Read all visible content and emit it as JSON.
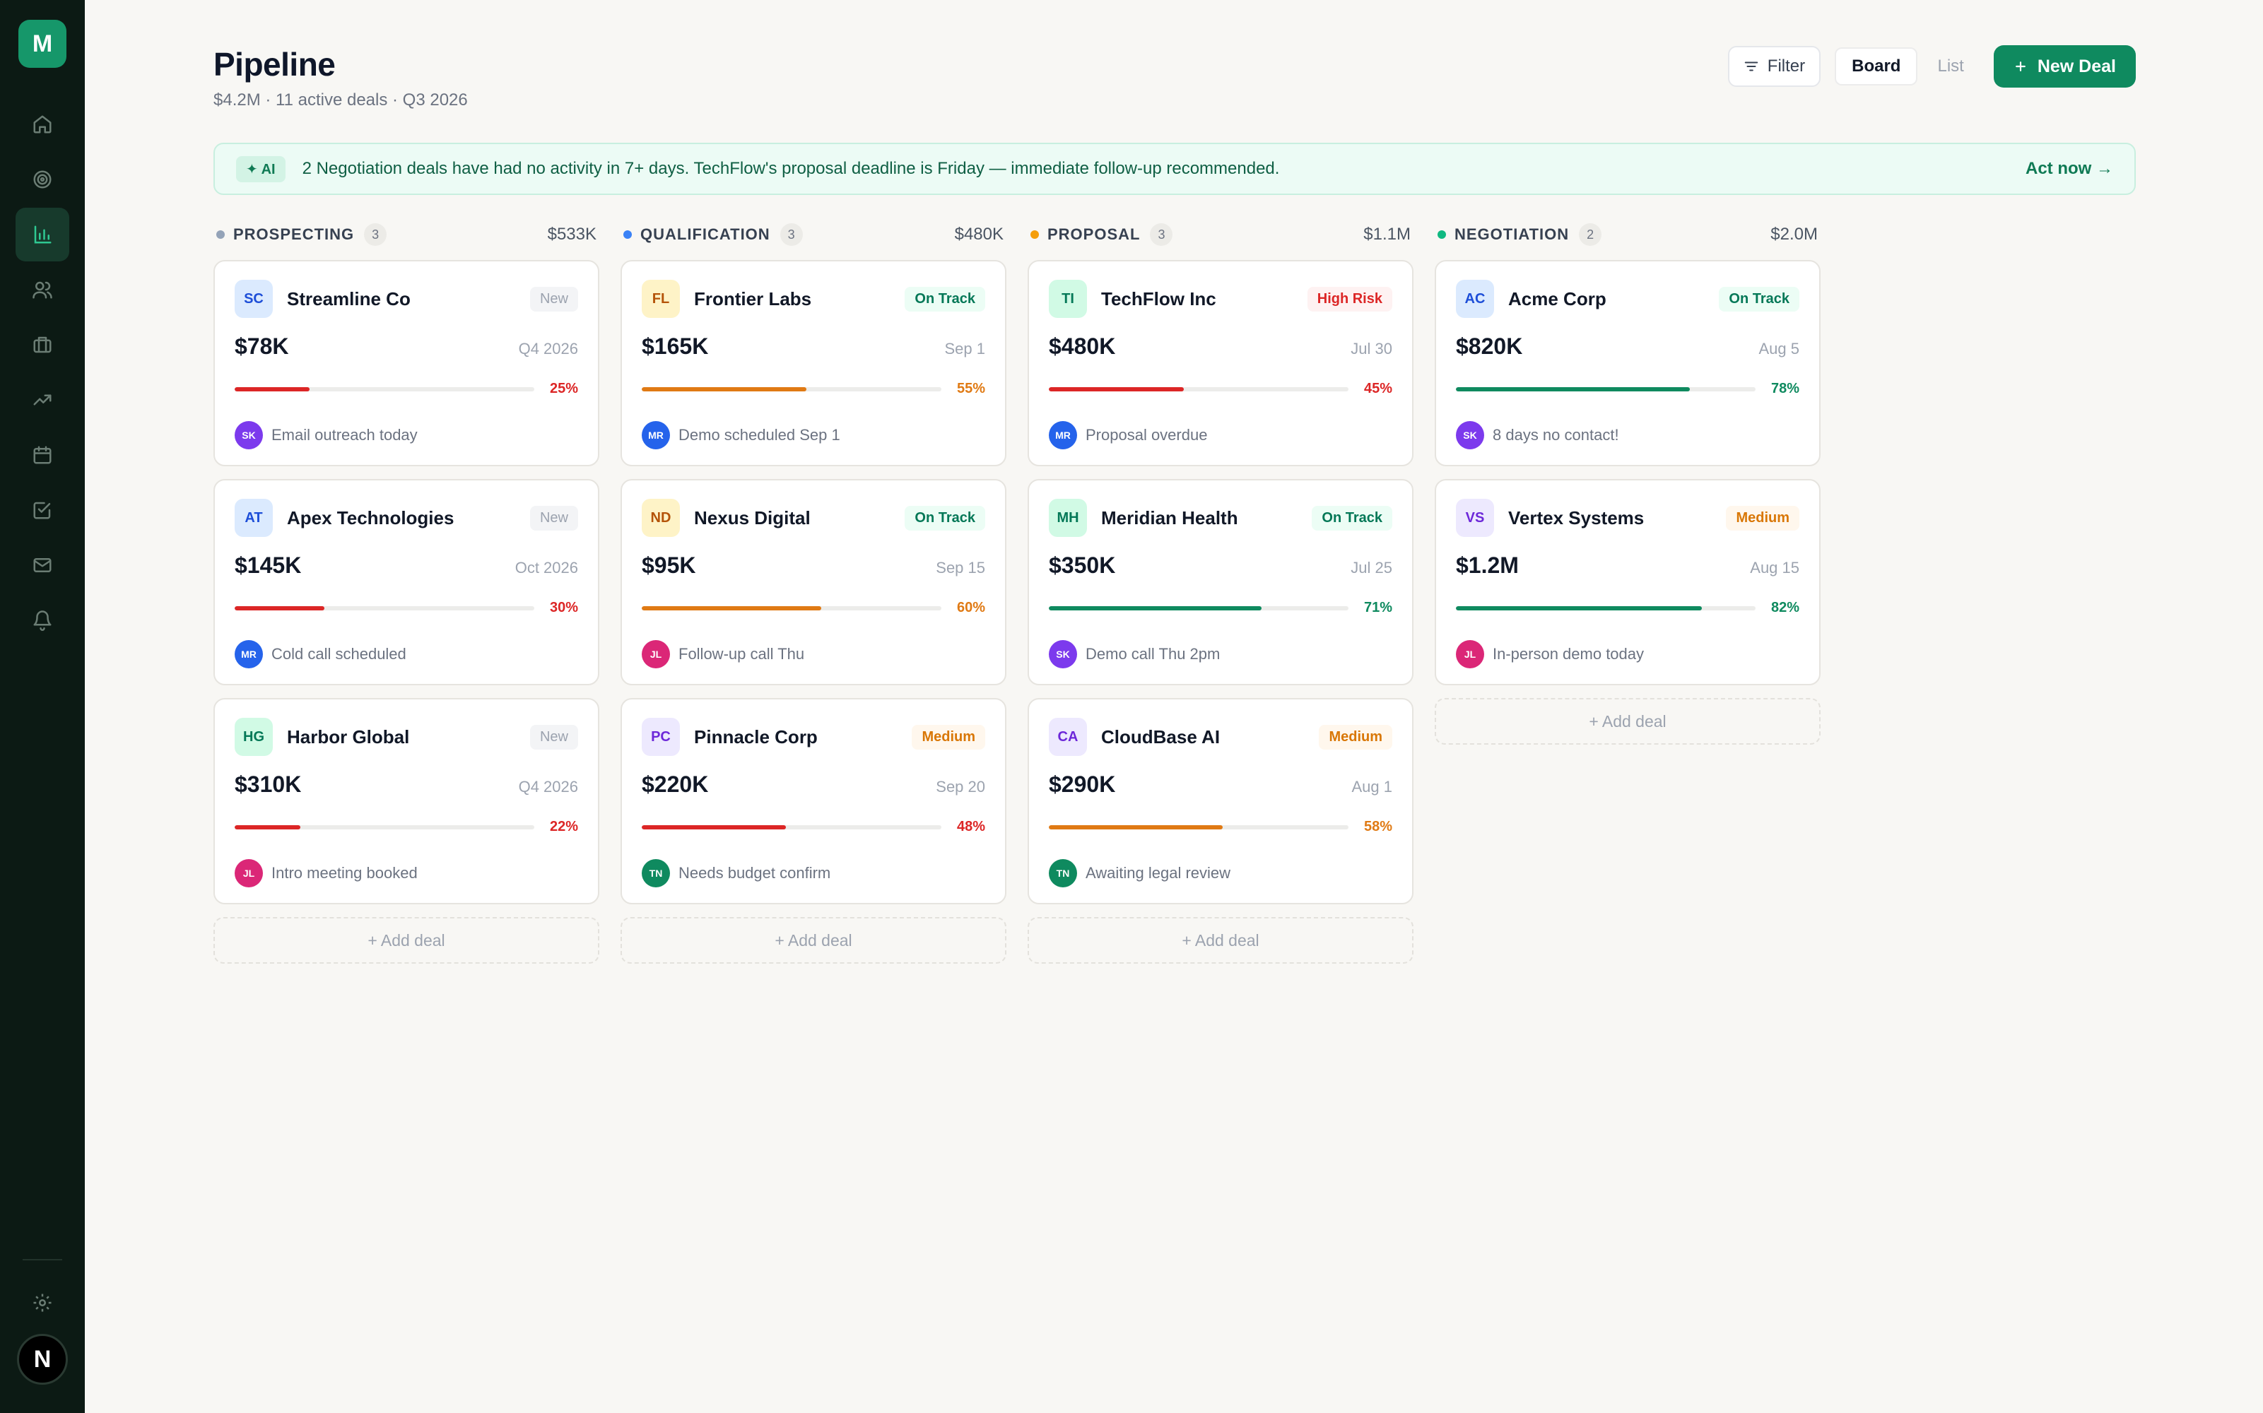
{
  "app": {
    "logo_letter": "M",
    "user_initial": "N"
  },
  "sidebar": {
    "items": [
      {
        "name": "home",
        "icon": "home-icon",
        "active": false
      },
      {
        "name": "targets",
        "icon": "target-icon",
        "active": false
      },
      {
        "name": "pipeline",
        "icon": "bar-chart-icon",
        "active": true
      },
      {
        "name": "contacts",
        "icon": "users-icon",
        "active": false
      },
      {
        "name": "companies",
        "icon": "briefcase-icon",
        "active": false
      },
      {
        "name": "analytics",
        "icon": "trending-up-icon",
        "active": false
      },
      {
        "name": "calendar",
        "icon": "calendar-icon",
        "active": false
      },
      {
        "name": "tasks",
        "icon": "checkbox-icon",
        "active": false
      },
      {
        "name": "mail",
        "icon": "mail-icon",
        "active": false
      },
      {
        "name": "notifications",
        "icon": "bell-icon",
        "active": false
      }
    ]
  },
  "header": {
    "title": "Pipeline",
    "subtitle": "$4.2M · 11 active deals · Q3 2026",
    "filter_label": "Filter",
    "view_board": "Board",
    "view_list": "List",
    "new_deal_label": "New Deal"
  },
  "banner": {
    "badge": "✦ AI",
    "text": "2 Negotiation deals have had no activity in 7+ days. TechFlow's proposal deadline is Friday — immediate follow-up recommended.",
    "action": "Act now →"
  },
  "add_deal_label": "+ Add deal",
  "colors": {
    "avatar_bg": {
      "blue": "#dbeafe",
      "yellow": "#fef3c7",
      "green": "#d1fae5",
      "purple": "#ede9fe"
    },
    "avatar_fg": {
      "blue": "#1d4ed8",
      "yellow": "#b45309",
      "green": "#047857",
      "purple": "#6d28d9"
    },
    "owners": {
      "SK": "#7c3aed",
      "MR": "#2563eb",
      "JL": "#db2777",
      "TN": "#0f8a5f"
    },
    "progress": {
      "low": "#dc2626",
      "mid": "#e07a14",
      "high": "#0f8a5f"
    }
  },
  "columns": [
    {
      "name": "PROSPECTING",
      "count": "3",
      "total": "$533K",
      "dot": "#94a3b8",
      "deals": [
        {
          "initials": "SC",
          "avatar": "blue",
          "company": "Streamline Co",
          "status": "New",
          "status_type": "new",
          "amount": "$78K",
          "date": "Q4 2026",
          "progress": 25,
          "pct": "25%",
          "level": "low",
          "owner": "SK",
          "activity": "Email outreach today"
        },
        {
          "initials": "AT",
          "avatar": "blue",
          "company": "Apex Technologies",
          "status": "New",
          "status_type": "new",
          "amount": "$145K",
          "date": "Oct 2026",
          "progress": 30,
          "pct": "30%",
          "level": "low",
          "owner": "MR",
          "activity": "Cold call scheduled"
        },
        {
          "initials": "HG",
          "avatar": "green",
          "company": "Harbor Global",
          "status": "New",
          "status_type": "new",
          "amount": "$310K",
          "date": "Q4 2026",
          "progress": 22,
          "pct": "22%",
          "level": "low",
          "owner": "JL",
          "activity": "Intro meeting booked"
        }
      ]
    },
    {
      "name": "QUALIFICATION",
      "count": "3",
      "total": "$480K",
      "dot": "#3b82f6",
      "deals": [
        {
          "initials": "FL",
          "avatar": "yellow",
          "company": "Frontier Labs",
          "status": "On Track",
          "status_type": "ontrack",
          "amount": "$165K",
          "date": "Sep 1",
          "progress": 55,
          "pct": "55%",
          "level": "mid",
          "owner": "MR",
          "activity": "Demo scheduled Sep 1"
        },
        {
          "initials": "ND",
          "avatar": "yellow",
          "company": "Nexus Digital",
          "status": "On Track",
          "status_type": "ontrack",
          "amount": "$95K",
          "date": "Sep 15",
          "progress": 60,
          "pct": "60%",
          "level": "mid",
          "owner": "JL",
          "activity": "Follow-up call Thu"
        },
        {
          "initials": "PC",
          "avatar": "purple",
          "company": "Pinnacle Corp",
          "status": "Medium",
          "status_type": "medium",
          "amount": "$220K",
          "date": "Sep 20",
          "progress": 48,
          "pct": "48%",
          "level": "low",
          "owner": "TN",
          "activity": "Needs budget confirm"
        }
      ]
    },
    {
      "name": "PROPOSAL",
      "count": "3",
      "total": "$1.1M",
      "dot": "#f59e0b",
      "deals": [
        {
          "initials": "TI",
          "avatar": "green",
          "company": "TechFlow Inc",
          "status": "High Risk",
          "status_type": "highrisk",
          "amount": "$480K",
          "date": "Jul 30",
          "progress": 45,
          "pct": "45%",
          "level": "low",
          "owner": "MR",
          "activity": "Proposal overdue"
        },
        {
          "initials": "MH",
          "avatar": "green",
          "company": "Meridian Health",
          "status": "On Track",
          "status_type": "ontrack",
          "amount": "$350K",
          "date": "Jul 25",
          "progress": 71,
          "pct": "71%",
          "level": "high",
          "owner": "SK",
          "activity": "Demo call Thu 2pm"
        },
        {
          "initials": "CA",
          "avatar": "purple",
          "company": "CloudBase AI",
          "status": "Medium",
          "status_type": "medium",
          "amount": "$290K",
          "date": "Aug 1",
          "progress": 58,
          "pct": "58%",
          "level": "mid",
          "owner": "TN",
          "activity": "Awaiting legal review"
        }
      ]
    },
    {
      "name": "NEGOTIATION",
      "count": "2",
      "total": "$2.0M",
      "dot": "#10b981",
      "deals": [
        {
          "initials": "AC",
          "avatar": "blue",
          "company": "Acme Corp",
          "status": "On Track",
          "status_type": "ontrack",
          "amount": "$820K",
          "date": "Aug 5",
          "progress": 78,
          "pct": "78%",
          "level": "high",
          "owner": "SK",
          "activity": "8 days no contact!"
        },
        {
          "initials": "VS",
          "avatar": "purple",
          "company": "Vertex Systems",
          "status": "Medium",
          "status_type": "medium",
          "amount": "$1.2M",
          "date": "Aug 15",
          "progress": 82,
          "pct": "82%",
          "level": "high",
          "owner": "JL",
          "activity": "In-person demo today"
        }
      ]
    }
  ]
}
